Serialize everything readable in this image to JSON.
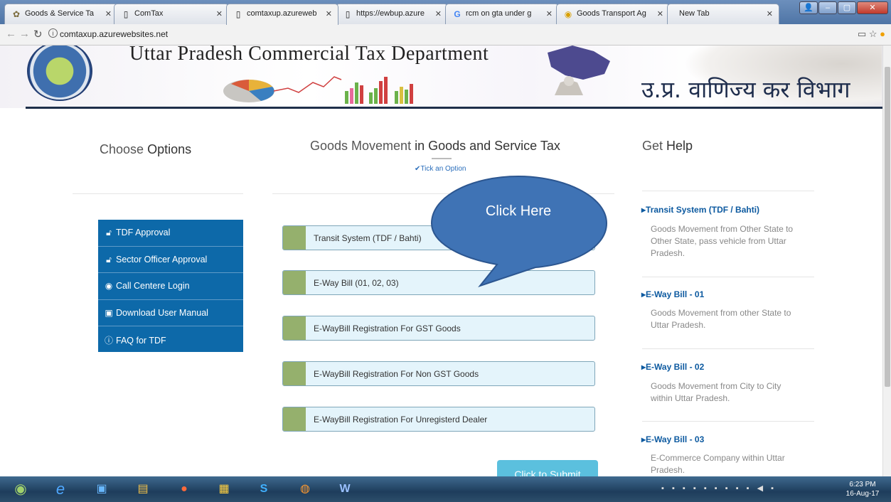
{
  "browser": {
    "tabs": [
      {
        "label": "Goods & Service Ta",
        "icon": "govt-favicon"
      },
      {
        "label": "ComTax",
        "icon": "page-icon"
      },
      {
        "label": "comtaxup.azureweb",
        "icon": "page-icon"
      },
      {
        "label": "https://ewbup.azure",
        "icon": "page-icon"
      },
      {
        "label": "rcm on gta under g",
        "icon": "google-icon"
      },
      {
        "label": "Goods Transport Ag",
        "icon": "site-icon"
      },
      {
        "label": "New Tab",
        "icon": ""
      }
    ],
    "url": "comtaxup.azurewebsites.net"
  },
  "header": {
    "department": "Uttar Pradesh Commercial Tax Department",
    "department_hindi": "उ.प्र. वाणिज्य कर विभाग"
  },
  "left": {
    "title_light": "Choose",
    "title_bold": "Options",
    "menu": [
      {
        "label": "TDF Approval",
        "icon": "lock-icon"
      },
      {
        "label": "Sector Officer Approval",
        "icon": "lock-icon"
      },
      {
        "label": "Call Centere Login",
        "icon": "user-circle-icon"
      },
      {
        "label": "Download User Manual",
        "icon": "pdf-icon"
      },
      {
        "label": "FAQ for TDF",
        "icon": "info-icon"
      }
    ]
  },
  "center": {
    "title_light": "Goods Movement",
    "title_bold": "in Goods and Service Tax",
    "tick_hint": "Tick an Option",
    "options": [
      "Transit System (TDF / Bahti)",
      "E-Way Bill (01, 02, 03)",
      "E-WayBill Registration For GST Goods",
      "E-WayBill Registration For Non GST Goods",
      "E-WayBill Registration For Unregisterd Dealer"
    ],
    "submit_label": "Click to Submit",
    "callout": "Click Here"
  },
  "help": {
    "title_light": "Get",
    "title_bold": "Help",
    "items": [
      {
        "heading": "Transit System (TDF / Bahti)",
        "text": "Goods Movement from Other State to Other State, pass vehicle from Uttar Pradesh."
      },
      {
        "heading": "E-Way Bill - 01",
        "text": "Goods Movement from other State to Uttar Pradesh."
      },
      {
        "heading": "E-Way Bill - 02",
        "text": "Goods Movement from City to City within Uttar Pradesh."
      },
      {
        "heading": "E-Way Bill - 03",
        "text": "E-Commerce Company within Uttar Pradesh."
      }
    ]
  },
  "taskbar": {
    "time": "6:23 PM",
    "date": "16-Aug-17"
  },
  "colors": {
    "menu_bg": "#0d69a9",
    "option_bg": "#e4f4fb",
    "option_bar": "#95b06d",
    "help_link": "#0d5aa0",
    "submit": "#5bc0de",
    "callout": "#3f73b5"
  }
}
